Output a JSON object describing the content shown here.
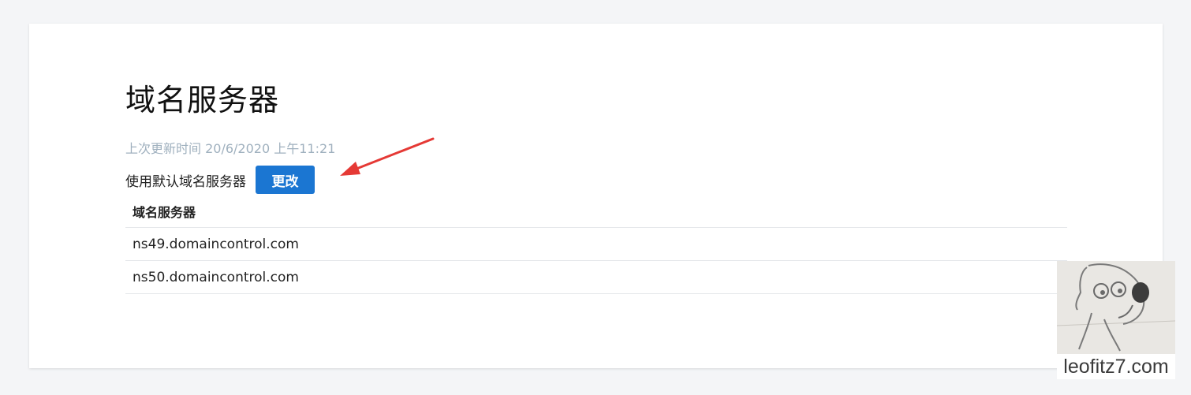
{
  "page": {
    "title": "域名服务器",
    "last_updated": "上次更新时间 20/6/2020 上午11:21",
    "default_label": "使用默认域名服务器",
    "change_button": "更改"
  },
  "table": {
    "header": "域名服务器",
    "rows": [
      "ns49.domaincontrol.com",
      "ns50.domaincontrol.com"
    ]
  },
  "watermark": {
    "text": "leofitz7.com"
  },
  "colors": {
    "accent": "#1b76d2",
    "arrow": "#e53935",
    "muted_text": "#9fb0be",
    "background": "#f4f5f7"
  }
}
